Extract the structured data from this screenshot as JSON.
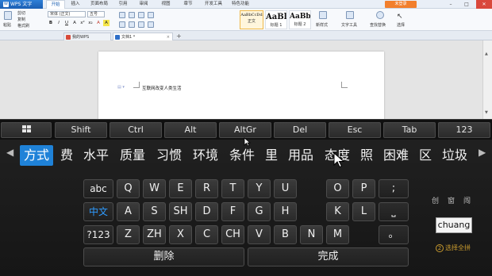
{
  "wps": {
    "app_name": "WPS 文字",
    "tabs": [
      "开始",
      "插入",
      "页面布局",
      "引用",
      "审阅",
      "视图",
      "章节",
      "开发工具",
      "特色功能"
    ],
    "active_tab": "开始",
    "login_label": "未登录",
    "window_controls": [
      "–",
      "□",
      "✕"
    ]
  },
  "ribbon": {
    "paste_label": "粘贴",
    "cut_label": "剪切",
    "copy_label": "复制",
    "format_painter_label": "格式刷",
    "font_name": "宋体 (正文)",
    "font_size": "五号",
    "format_buttons": [
      "B",
      "I",
      "U",
      "A",
      "x²",
      "x₂",
      "A",
      "A"
    ],
    "styles": [
      {
        "sample": "AaBbCcDd",
        "label": "正文"
      },
      {
        "sample": "AaBl",
        "label": "标题 1"
      },
      {
        "sample": "AaBb(",
        "label": "标题 2"
      }
    ],
    "new_style_label": "新样式",
    "text_tools_label": "文字工具",
    "find_replace_label": "查找替换",
    "select_label": "选择"
  },
  "document_tabs": [
    {
      "label": "我的WPS",
      "icon_color": "#d84a3a"
    },
    {
      "label": "文档1 *",
      "icon_color": "#2f6fc8"
    }
  ],
  "document": {
    "text": "互联网改变人类生活"
  },
  "keyboard": {
    "modifier_keys": [
      "Shift",
      "Ctrl",
      "Alt",
      "AltGr",
      "Del",
      "Esc",
      "Tab",
      "123"
    ],
    "candidates": [
      "方式",
      "费",
      "水平",
      "质量",
      "习惯",
      "环境",
      "条件",
      "里",
      "用品",
      "态度",
      "照",
      "困难",
      "区",
      "垃圾"
    ],
    "selected_candidate": "方式",
    "left_arrow": "◀",
    "right_arrow": "▶",
    "row1": [
      "abc",
      "Q",
      "W",
      "E",
      "R",
      "T",
      "Y",
      "U",
      "O",
      "P",
      ";"
    ],
    "row2": [
      "中文",
      "A",
      "S",
      "SH",
      "D",
      "F",
      "G",
      "H",
      "K",
      "L",
      "⎵"
    ],
    "row3": [
      "?123",
      "Z",
      "ZH",
      "X",
      "C",
      "CH",
      "V",
      "B",
      "N",
      "M",
      "。"
    ],
    "delete_label": "删除",
    "done_label": "完成",
    "side_suggestions": [
      "创",
      "窗",
      "闯"
    ],
    "pinyin": "chuang",
    "hint_number": "2",
    "hint_label": "选择全拼"
  }
}
